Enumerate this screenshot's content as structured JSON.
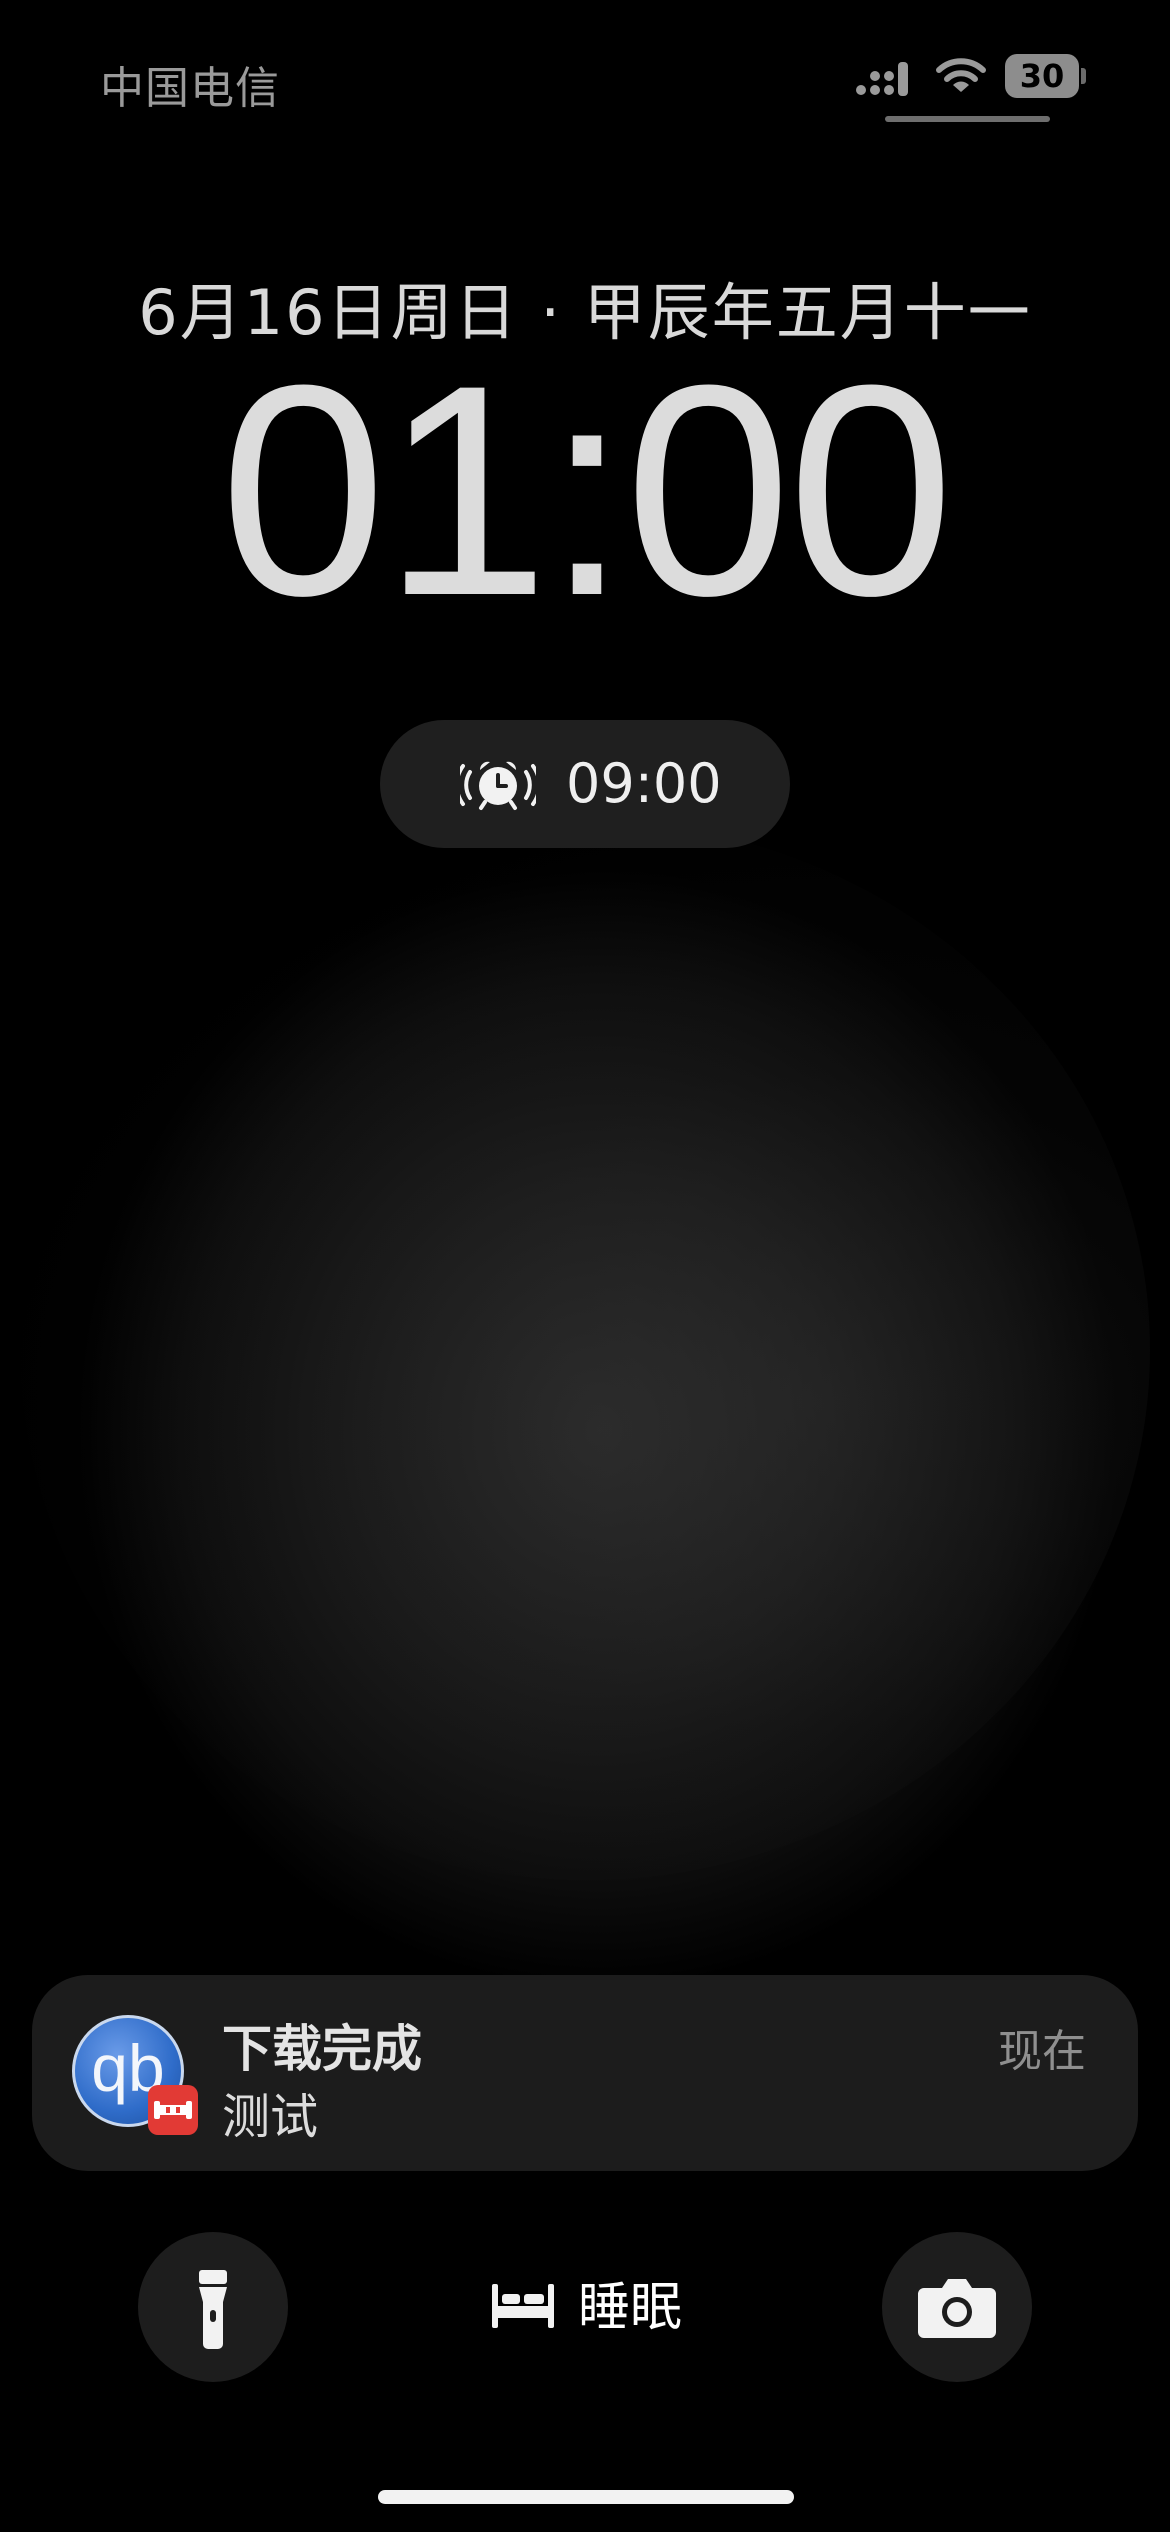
{
  "status_bar": {
    "carrier": "中国电信",
    "battery_level": "30",
    "icons": [
      "signal-icon",
      "wifi-icon",
      "battery-icon"
    ]
  },
  "lock_screen": {
    "date": "6月16日周日 · 甲辰年五月十一",
    "time": "01:00",
    "alarm": {
      "icon": "alarm-clock-icon",
      "time": "09:00"
    }
  },
  "notification": {
    "app_icon_text": "qb",
    "title": "下载完成",
    "body": "测试",
    "timestamp": "现在",
    "colors": {
      "app_icon": "#2f6cc9",
      "badge": "#e23a35"
    }
  },
  "bottom_controls": {
    "left": "flashlight-icon",
    "focus": {
      "icon": "bed-icon",
      "label": "睡眠"
    },
    "right": "camera-icon"
  }
}
